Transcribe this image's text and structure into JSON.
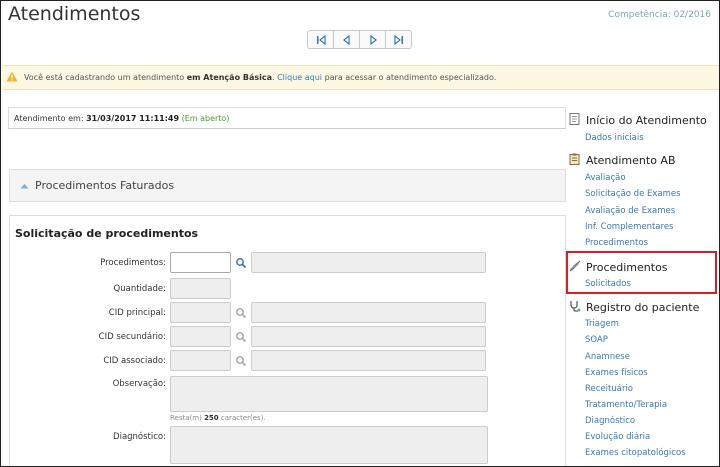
{
  "page": {
    "title": "Atendimentos",
    "competencia": "Competência: 02/2016"
  },
  "pager": {
    "first_icon": "first-page-icon",
    "prev_icon": "prev-page-icon",
    "next_icon": "next-page-icon",
    "last_icon": "last-page-icon"
  },
  "alert": {
    "icon": "warning-icon",
    "text_before": "Você está cadastrando um atendimento",
    "bold_text": "em Atenção Básica",
    "link_text": "Clique aqui",
    "text_after": "para acessar o atendimento especializado."
  },
  "atendimento": {
    "label": "Atendimento em:",
    "datetime": "31/03/2017 11:11:49",
    "status": "(Em aberto)"
  },
  "faturados": {
    "icon": "chevron-up-icon",
    "label": "Procedimentos Faturados"
  },
  "form": {
    "title": "Solicitação de procedimentos",
    "fields": {
      "procedimentos": "Procedimentos:",
      "quantidade": "Quantidade:",
      "cid_principal": "CID principal:",
      "cid_secundario": "CID secundário:",
      "cid_associado": "CID associado:",
      "observacao": "Observação:",
      "diagnostico": "Diagnóstico:"
    },
    "remaining_prefix": "Resta(m)",
    "remaining_count": "250",
    "remaining_suffix": "caracter(es)."
  },
  "sidebar": {
    "sections": [
      {
        "title": "Início do Atendimento",
        "icon": "document-icon",
        "items": [
          "Dados iniciais"
        ]
      },
      {
        "title": "Atendimento AB",
        "icon": "clipboard-icon",
        "items": [
          "Avaliação",
          "Solicitação de Exames",
          "Avaliação de Exames",
          "Inf. Complementares",
          "Procedimentos"
        ]
      },
      {
        "title": "Procedimentos",
        "icon": "syringe-icon",
        "items": [
          "Solicitados"
        ]
      },
      {
        "title": "Registro do paciente",
        "icon": "stethoscope-icon",
        "items": [
          "Triagem",
          "SOAP",
          "Anamnese",
          "Exames físicos",
          "Receituário",
          "Tratamento/Terapia",
          "Diagnóstico",
          "Evolução diária",
          "Exames citopatológicos"
        ]
      }
    ]
  },
  "colors": {
    "link": "#3a77b8",
    "alert_bg": "#fcf8e3",
    "highlight": "#d42020",
    "status_green": "#4a9a2a"
  }
}
